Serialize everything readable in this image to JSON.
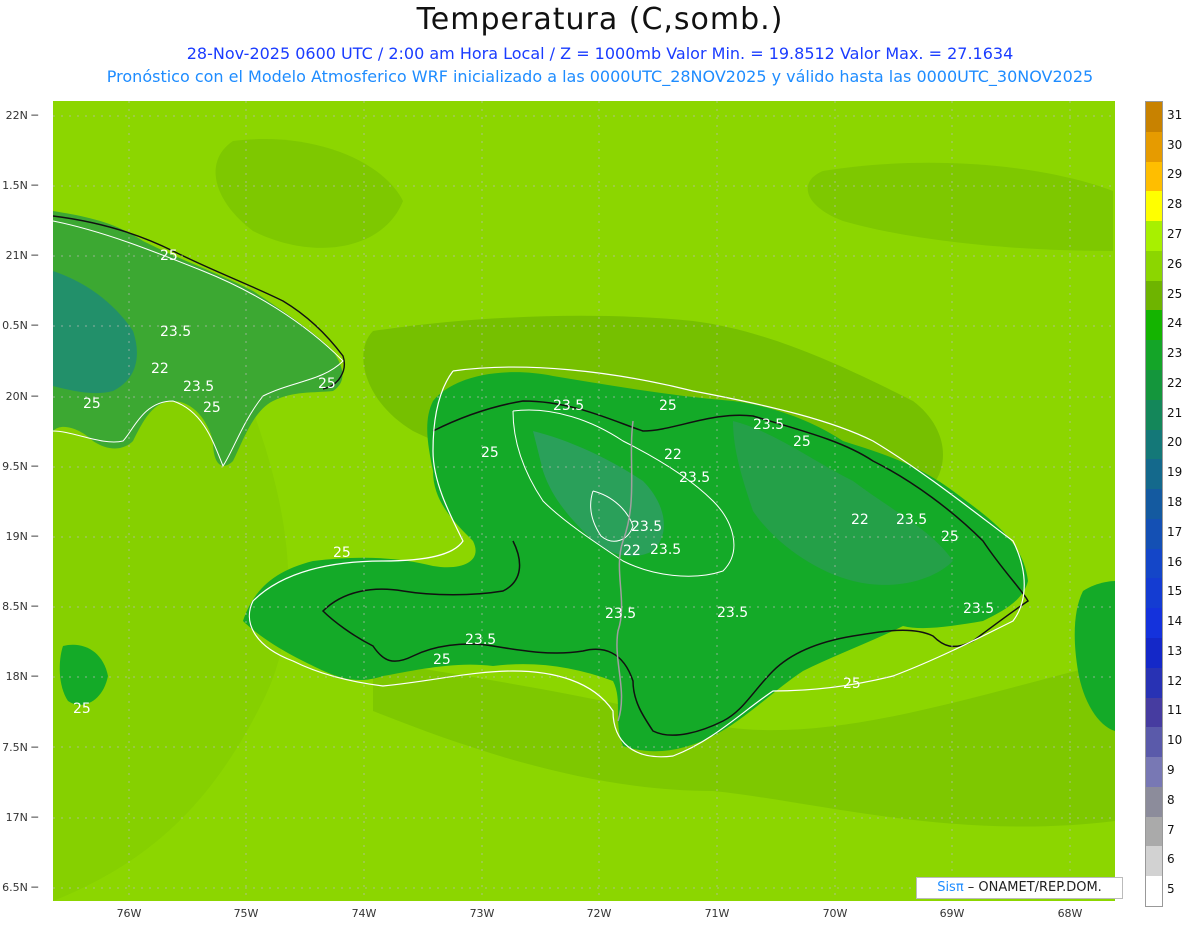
{
  "title": "Temperatura (C,somb.)",
  "subtitle1": "28-Nov-2025  0600 UTC / 2:00 am Hora Local / Z = 1000mb    Valor Min. = 19.8512   Valor Max. = 27.1634",
  "subtitle2": "Pronóstico con el Modelo Atmosferico WRF inicializado a las 0000UTC_28NOV2025 y válido hasta las  0000UTC_30NOV2025",
  "lat_labels": [
    "22N",
    "1.5N",
    "21N",
    "0.5N",
    "20N",
    "9.5N",
    "19N",
    "8.5N",
    "18N",
    "7.5N",
    "17N",
    "6.5N"
  ],
  "lon_labels": [
    "76W",
    "75W",
    "74W",
    "73W",
    "72W",
    "71W",
    "70W",
    "69W",
    "68W"
  ],
  "contour_labels": [
    "25",
    "23.5",
    "22",
    "23.5",
    "25",
    "25",
    "25",
    "23.5",
    "25",
    "25",
    "22",
    "23.5",
    "25",
    "23.5",
    "22",
    "23.5",
    "23.5",
    "22",
    "23.5",
    "25",
    "25",
    "23.5",
    "23.5",
    "25",
    "23.5",
    "23.5",
    "25",
    "25"
  ],
  "colorbar": {
    "labels": [
      "31",
      "30",
      "29",
      "28",
      "27",
      "26",
      "25",
      "24",
      "23",
      "22",
      "21",
      "20",
      "19",
      "18",
      "17",
      "16",
      "15",
      "14",
      "13",
      "12",
      "11",
      "10",
      "9",
      "8",
      "7",
      "6",
      "5"
    ],
    "colors": [
      "#c88200",
      "#e69b00",
      "#ffbe00",
      "#ffff00",
      "#a8f000",
      "#8cd600",
      "#6eb400",
      "#14b400",
      "#14a528",
      "#14963c",
      "#14875a",
      "#147878",
      "#14698c",
      "#145aa0",
      "#1450b4",
      "#1446c8",
      "#143cd2",
      "#1432dc",
      "#1428c8",
      "#2832b4",
      "#463ca0",
      "#5a5aaa",
      "#7878b4",
      "#8c8c9b",
      "#aaaaaa",
      "#d2d2d2",
      "#ffffff"
    ]
  },
  "credit": {
    "sis": "Sisπ",
    "rest": " – ONAMET/REP.DOM."
  }
}
